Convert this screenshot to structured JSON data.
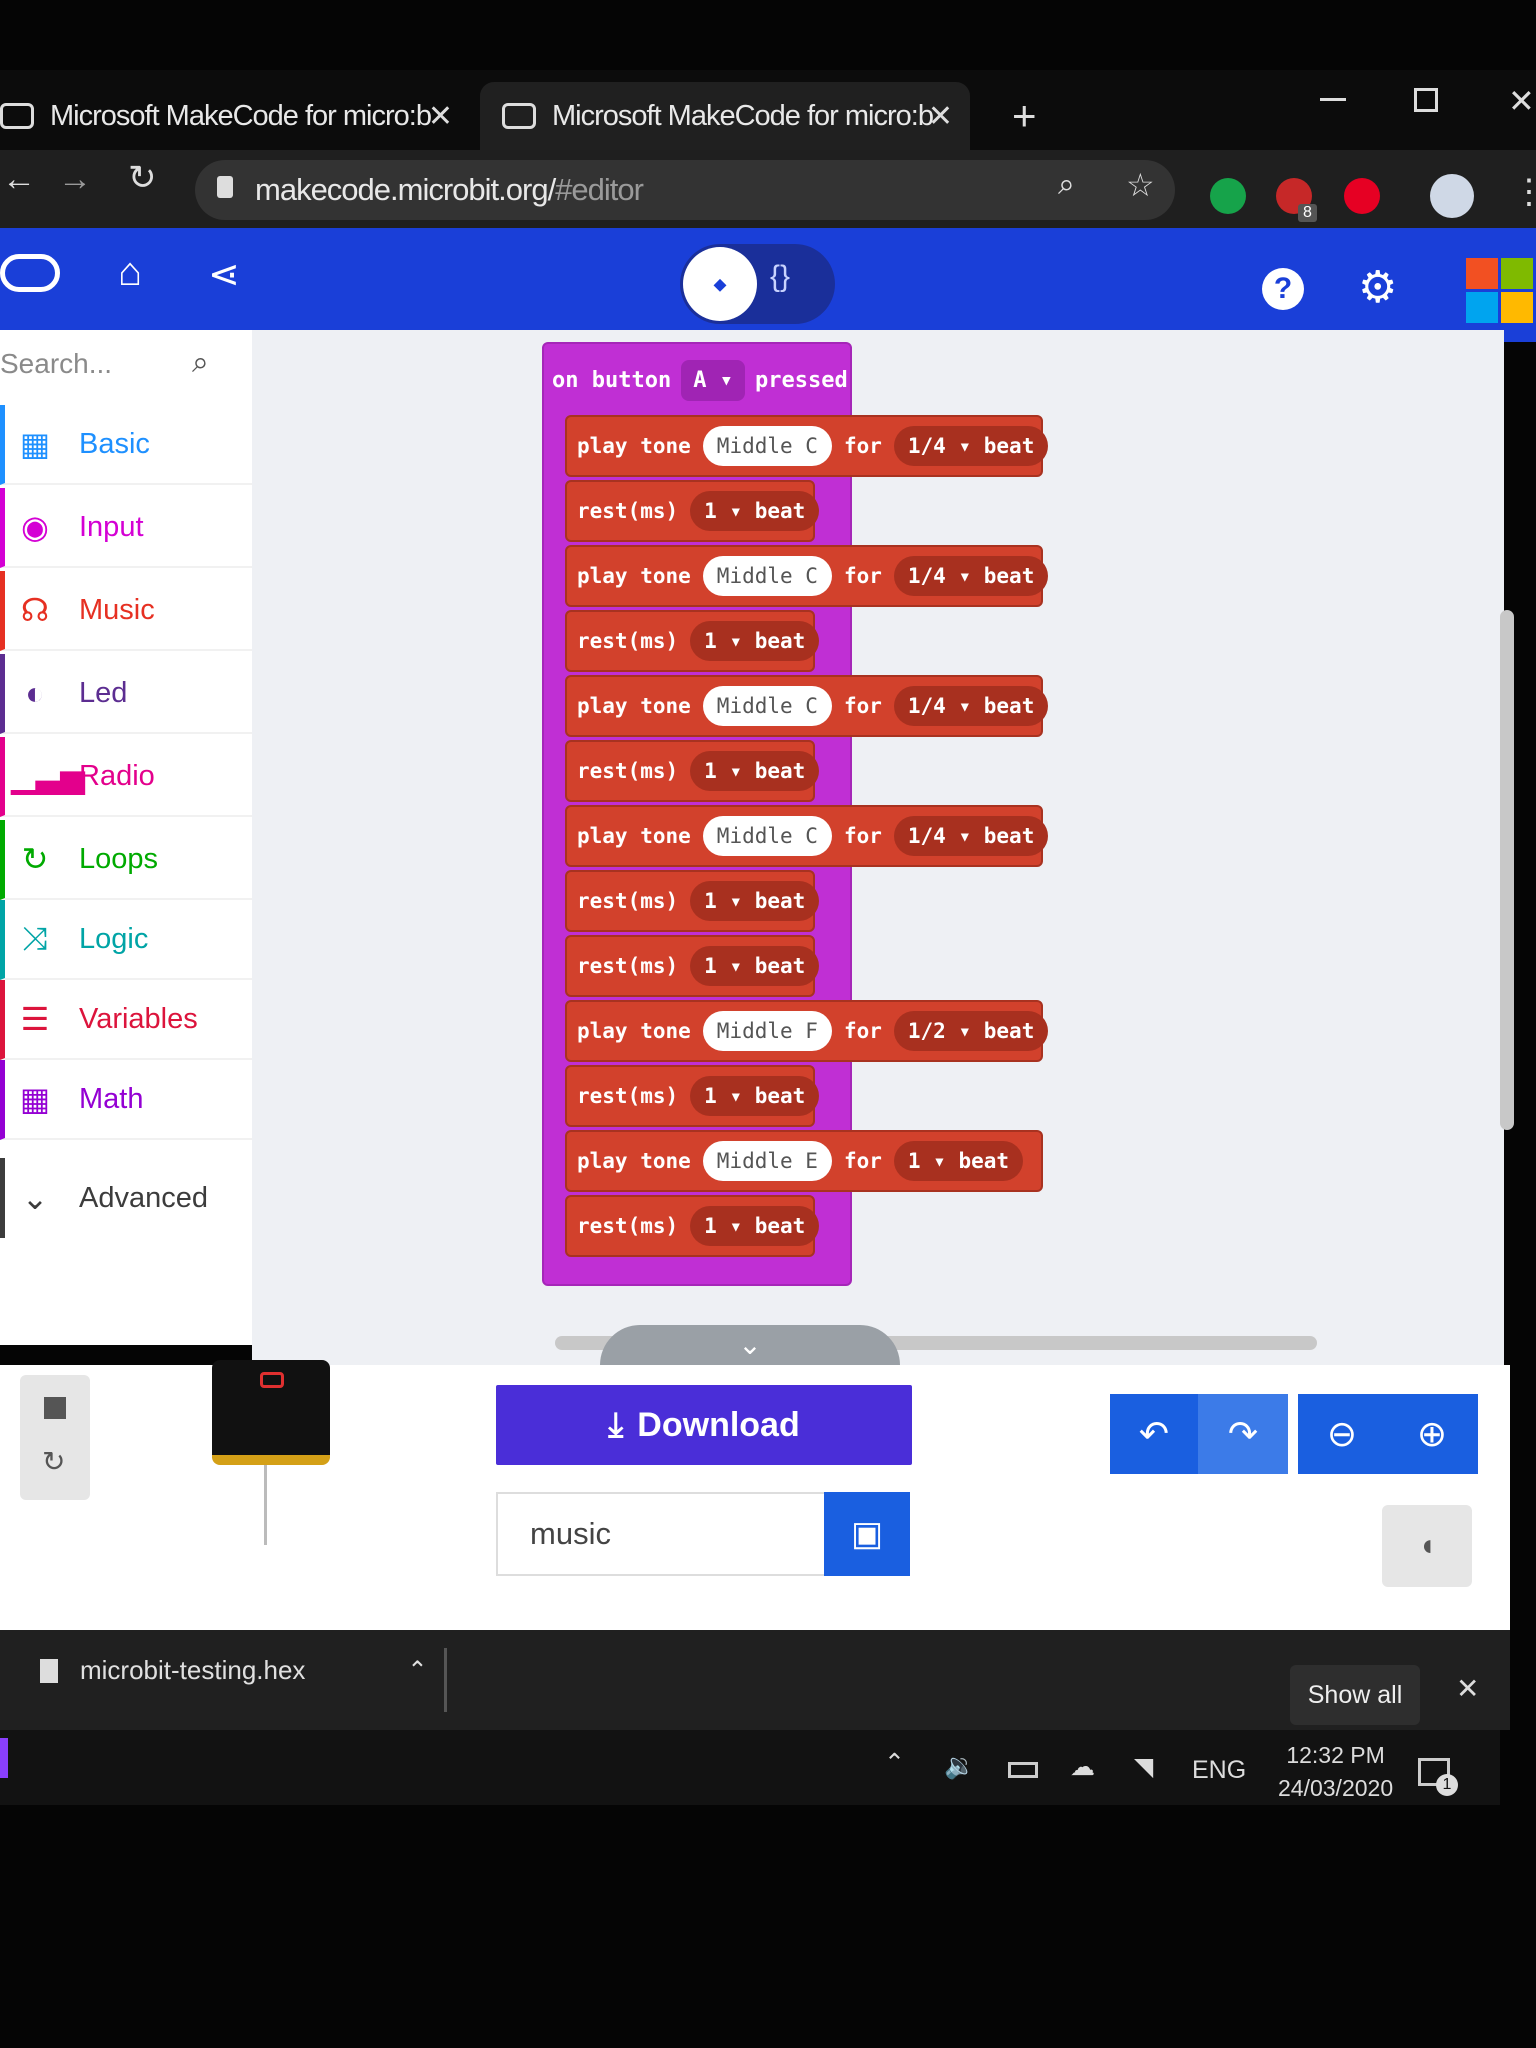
{
  "browser": {
    "tabs": [
      {
        "title": "Microsoft MakeCode for micro:b"
      },
      {
        "title": "Microsoft MakeCode for micro:b"
      }
    ],
    "close_glyph": "✕",
    "new_tab_glyph": "+",
    "url_domain": "makecode.microbit.org/",
    "url_path": "#editor",
    "extension_badge": "8"
  },
  "toolbar": {
    "toggle_blocks_glyph": "⬩",
    "toggle_js_label": "{}",
    "help_glyph": "?",
    "settings_glyph": "⚙"
  },
  "toolbox": {
    "search_placeholder": "Search...",
    "categories": [
      {
        "label": "Basic",
        "color": "#1e90ff"
      },
      {
        "label": "Input",
        "color": "#d400d4"
      },
      {
        "label": "Music",
        "color": "#e63022"
      },
      {
        "label": "Led",
        "color": "#5c2d91"
      },
      {
        "label": "Radio",
        "color": "#e3008c"
      },
      {
        "label": "Loops",
        "color": "#00aa00"
      },
      {
        "label": "Logic",
        "color": "#00a4a6"
      },
      {
        "label": "Variables",
        "color": "#dc143c"
      },
      {
        "label": "Math",
        "color": "#9400d3"
      },
      {
        "label": "Advanced",
        "color": "#3c3c3c"
      }
    ]
  },
  "workspace": {
    "event": {
      "prefix": "on button",
      "button": "A ▾",
      "suffix": "pressed"
    },
    "blocks": [
      {
        "kind": "tone",
        "note": "Middle C",
        "duration": "1/4 ▾",
        "unit": "beat"
      },
      {
        "kind": "rest",
        "duration": "1 ▾",
        "unit": "beat"
      },
      {
        "kind": "tone",
        "note": "Middle C",
        "duration": "1/4 ▾",
        "unit": "beat"
      },
      {
        "kind": "rest",
        "duration": "1 ▾",
        "unit": "beat"
      },
      {
        "kind": "tone",
        "note": "Middle C",
        "duration": "1/4 ▾",
        "unit": "beat"
      },
      {
        "kind": "rest",
        "duration": "1 ▾",
        "unit": "beat"
      },
      {
        "kind": "tone",
        "note": "Middle C",
        "duration": "1/4 ▾",
        "unit": "beat"
      },
      {
        "kind": "rest",
        "duration": "1 ▾",
        "unit": "beat"
      },
      {
        "kind": "rest",
        "duration": "1 ▾",
        "unit": "beat"
      },
      {
        "kind": "tone",
        "note": "Middle F",
        "duration": "1/2 ▾",
        "unit": "beat"
      },
      {
        "kind": "rest",
        "duration": "1 ▾",
        "unit": "beat"
      },
      {
        "kind": "tone",
        "note": "Middle E",
        "duration": "1 ▾",
        "unit": "beat"
      },
      {
        "kind": "rest",
        "duration": "1 ▾",
        "unit": "beat"
      }
    ],
    "tone_label": "play tone",
    "for_label": "for",
    "rest_label": "rest(ms)"
  },
  "editor": {
    "download_label": "Download",
    "project_name": "music"
  },
  "downloads": {
    "file_name": "microbit-testing.hex",
    "show_all_label": "Show all"
  },
  "taskbar": {
    "language": "ENG",
    "time": "12:32 PM",
    "date": "24/03/2020",
    "notification_count": "1"
  },
  "colors": {
    "header_blue": "#1a3fd8",
    "event_purple": "#c02fd4",
    "music_red": "#d2412c",
    "download_purple": "#4a2ed8"
  }
}
